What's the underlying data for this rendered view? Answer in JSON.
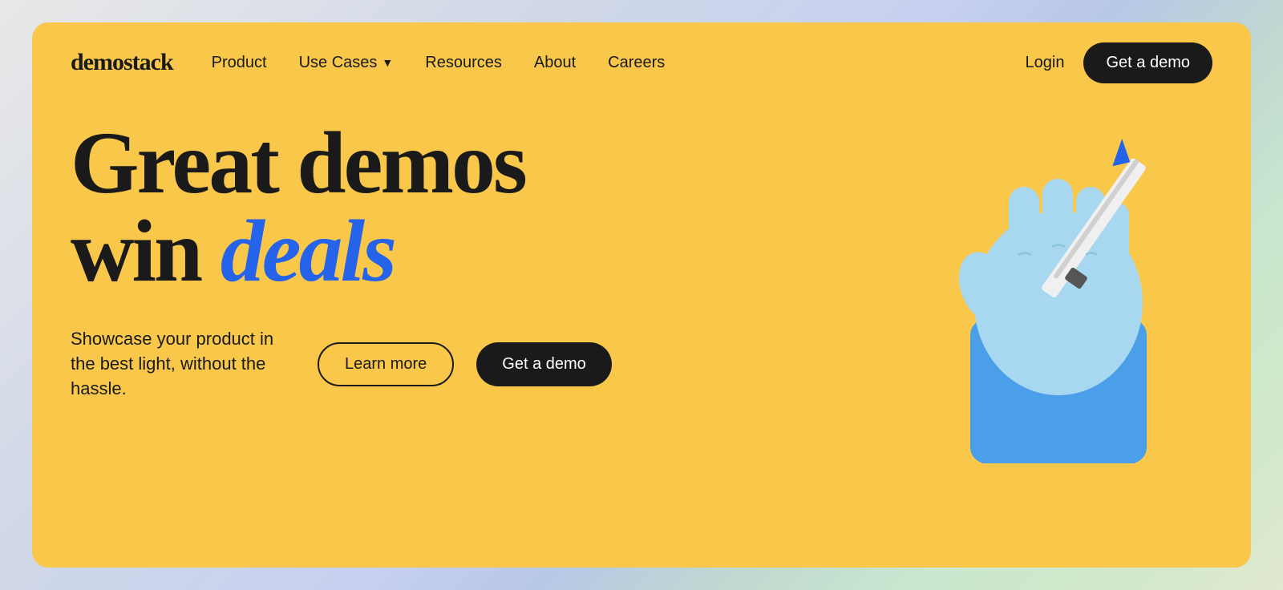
{
  "brand": {
    "logo": "demostack"
  },
  "navbar": {
    "links": [
      {
        "label": "Product",
        "has_dropdown": false
      },
      {
        "label": "Use Cases",
        "has_dropdown": true
      },
      {
        "label": "Resources",
        "has_dropdown": false
      },
      {
        "label": "About",
        "has_dropdown": false
      },
      {
        "label": "Careers",
        "has_dropdown": false
      }
    ],
    "login_label": "Login",
    "cta_label": "Get a demo"
  },
  "hero": {
    "headline_part1": "Great demos",
    "headline_part2": "win ",
    "headline_deals": "deals",
    "subtitle": "Showcase your product in the best light, without the hassle.",
    "learn_more_label": "Learn more",
    "get_demo_label": "Get a demo"
  },
  "colors": {
    "background": "#F9C84A",
    "dark": "#1a1a1a",
    "blue_accent": "#2563EB",
    "white": "#ffffff"
  }
}
